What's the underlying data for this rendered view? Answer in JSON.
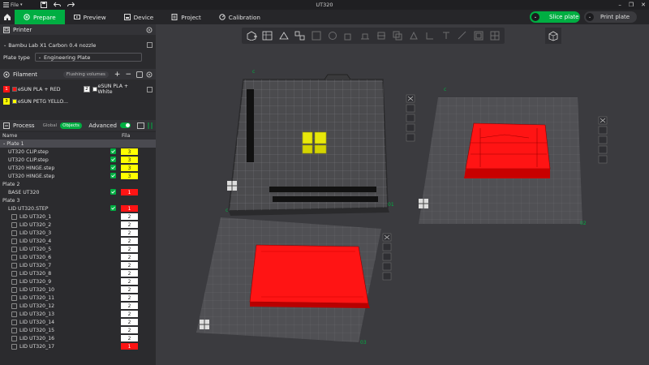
{
  "window": {
    "title": "UT320",
    "file_menu": "File"
  },
  "tabs": [
    {
      "label": "Prepare"
    },
    {
      "label": "Preview"
    },
    {
      "label": "Device"
    },
    {
      "label": "Project"
    },
    {
      "label": "Calibration"
    }
  ],
  "actions": {
    "slice": "Slice plate",
    "print": "Print plate"
  },
  "printer": {
    "section": "Printer",
    "selected": "Bambu Lab X1 Carbon 0.4 nozzle",
    "plate_type_label": "Plate type",
    "plate_type": "Engineering Plate"
  },
  "filament": {
    "section": "Filament",
    "flushing": "Flushing volumes",
    "items": [
      {
        "num": "1",
        "name": "eSUN PLA + RED",
        "color": "#ff1414"
      },
      {
        "num": "2",
        "name": "eSUN PLA + White",
        "color": "#ffffff"
      },
      {
        "num": "3",
        "name": "eSUN PETG YELLO...",
        "color": "#ffff00"
      }
    ]
  },
  "process": {
    "section": "Process",
    "global": "Global",
    "objects": "Objects",
    "advanced": "Advanced"
  },
  "table": {
    "col_name": "Name",
    "col_fila": "Fila",
    "rows": [
      {
        "name": "Plate 1",
        "indent": 0,
        "check": "none",
        "fila": "",
        "group": true,
        "sel": true
      },
      {
        "name": "UT320 CLIP.step",
        "indent": 1,
        "check": "on",
        "fila": "3"
      },
      {
        "name": "UT320 CLIP.step",
        "indent": 1,
        "check": "on",
        "fila": "3"
      },
      {
        "name": "UT320 HINGE.step",
        "indent": 1,
        "check": "on",
        "fila": "3"
      },
      {
        "name": "UT320 HINGE.step",
        "indent": 1,
        "check": "on",
        "fila": "3"
      },
      {
        "name": "Plate 2",
        "indent": 0,
        "check": "none",
        "fila": "",
        "group": true
      },
      {
        "name": "BASE UT320",
        "indent": 1,
        "check": "on",
        "fila": "1"
      },
      {
        "name": "Plate 3",
        "indent": 0,
        "check": "none",
        "fila": "",
        "group": true
      },
      {
        "name": "LID UT320.STEP",
        "indent": 1,
        "check": "on",
        "fila": "1"
      },
      {
        "name": "LID UT320_1",
        "indent": 2,
        "check": "off",
        "fila": "2"
      },
      {
        "name": "LID UT320_2",
        "indent": 2,
        "check": "off",
        "fila": "2"
      },
      {
        "name": "LID UT320_3",
        "indent": 2,
        "check": "off",
        "fila": "2"
      },
      {
        "name": "LID UT320_4",
        "indent": 2,
        "check": "off",
        "fila": "2"
      },
      {
        "name": "LID UT320_5",
        "indent": 2,
        "check": "off",
        "fila": "2"
      },
      {
        "name": "LID UT320_6",
        "indent": 2,
        "check": "off",
        "fila": "2"
      },
      {
        "name": "LID UT320_7",
        "indent": 2,
        "check": "off",
        "fila": "2"
      },
      {
        "name": "LID UT320_8",
        "indent": 2,
        "check": "off",
        "fila": "2"
      },
      {
        "name": "LID UT320_9",
        "indent": 2,
        "check": "off",
        "fila": "2"
      },
      {
        "name": "LID UT320_10",
        "indent": 2,
        "check": "off",
        "fila": "2"
      },
      {
        "name": "LID UT320_11",
        "indent": 2,
        "check": "off",
        "fila": "2"
      },
      {
        "name": "LID UT320_12",
        "indent": 2,
        "check": "off",
        "fila": "2"
      },
      {
        "name": "LID UT320_13",
        "indent": 2,
        "check": "off",
        "fila": "2"
      },
      {
        "name": "LID UT320_14",
        "indent": 2,
        "check": "off",
        "fila": "2"
      },
      {
        "name": "LID UT320_15",
        "indent": 2,
        "check": "off",
        "fila": "2"
      },
      {
        "name": "LID UT320_16",
        "indent": 2,
        "check": "off",
        "fila": "2"
      },
      {
        "name": "LID UT320_17",
        "indent": 2,
        "check": "off",
        "fila": "1"
      }
    ]
  },
  "viewport": {
    "plates": [
      {
        "label": "01"
      },
      {
        "label": "02"
      },
      {
        "label": "03"
      }
    ]
  },
  "colors": {
    "accent": "#00ae42",
    "red": "#ff1414",
    "yellow": "#ffff00",
    "white": "#ffffff"
  }
}
